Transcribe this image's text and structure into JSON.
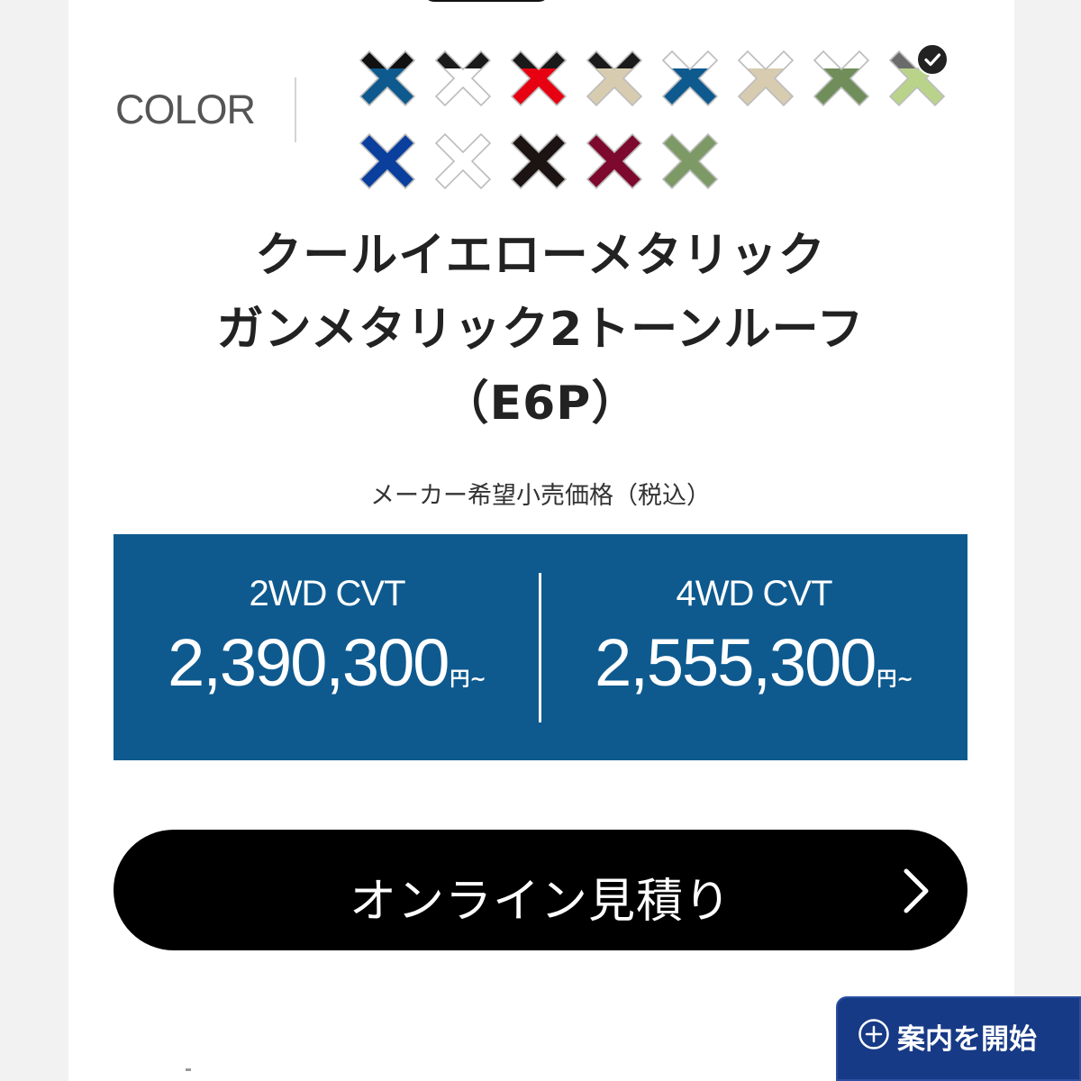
{
  "color_section": {
    "label": "COLOR",
    "selected_index": 7,
    "swatches": [
      {
        "top": "#111111",
        "bottom": "#0e5a8f",
        "outline": "#bcbcbc"
      },
      {
        "top": "#1a1a1a",
        "bottom": "#ffffff",
        "outline": "#bcbcbc"
      },
      {
        "top": "#1a1a1a",
        "bottom": "#e60012",
        "outline": "#bcbcbc"
      },
      {
        "top": "#1a1a1a",
        "bottom": "#d8ccb0",
        "outline": "#bcbcbc"
      },
      {
        "top": "#ffffff",
        "bottom": "#0e5a8f",
        "outline": "#bcbcbc"
      },
      {
        "top": "#ffffff",
        "bottom": "#d8ccb0",
        "outline": "#bcbcbc"
      },
      {
        "top": "#ffffff",
        "bottom": "#6f8e5a",
        "outline": "#bcbcbc"
      },
      {
        "top": "#6b6b6b",
        "bottom": "#b9d48a",
        "outline": "#bcbcbc"
      },
      {
        "top": "#0a3f9e",
        "bottom": "#0a3f9e",
        "outline": "#bcbcbc"
      },
      {
        "top": "#ffffff",
        "bottom": "#ffffff",
        "outline": "#bcbcbc"
      },
      {
        "top": "#1c1412",
        "bottom": "#1c1412",
        "outline": "#bcbcbc"
      },
      {
        "top": "#7d0a2e",
        "bottom": "#7d0a2e",
        "outline": "#bcbcbc"
      },
      {
        "top": "#7d9a66",
        "bottom": "#7d9a66",
        "outline": "#bcbcbc"
      }
    ]
  },
  "color_name": {
    "line1": "クールイエローメタリック",
    "line2": "ガンメタリック2トーンルーフ",
    "line3": "（E6P）"
  },
  "price": {
    "caption": "メーカー希望小売価格（税込）",
    "options": [
      {
        "drive": "2WD CVT",
        "value": "2,390,300",
        "suffix": "円~"
      },
      {
        "drive": "4WD CVT",
        "value": "2,555,300",
        "suffix": "円~"
      }
    ]
  },
  "cta": {
    "label": "オンライン見積り",
    "icon": "chevron-right-icon"
  },
  "guide": {
    "label": "案内を開始",
    "icon": "plus-circle-icon"
  },
  "colors": {
    "price_box": "#0e5a8f",
    "cta_bg": "#000000",
    "guide_bg": "#173a86"
  }
}
